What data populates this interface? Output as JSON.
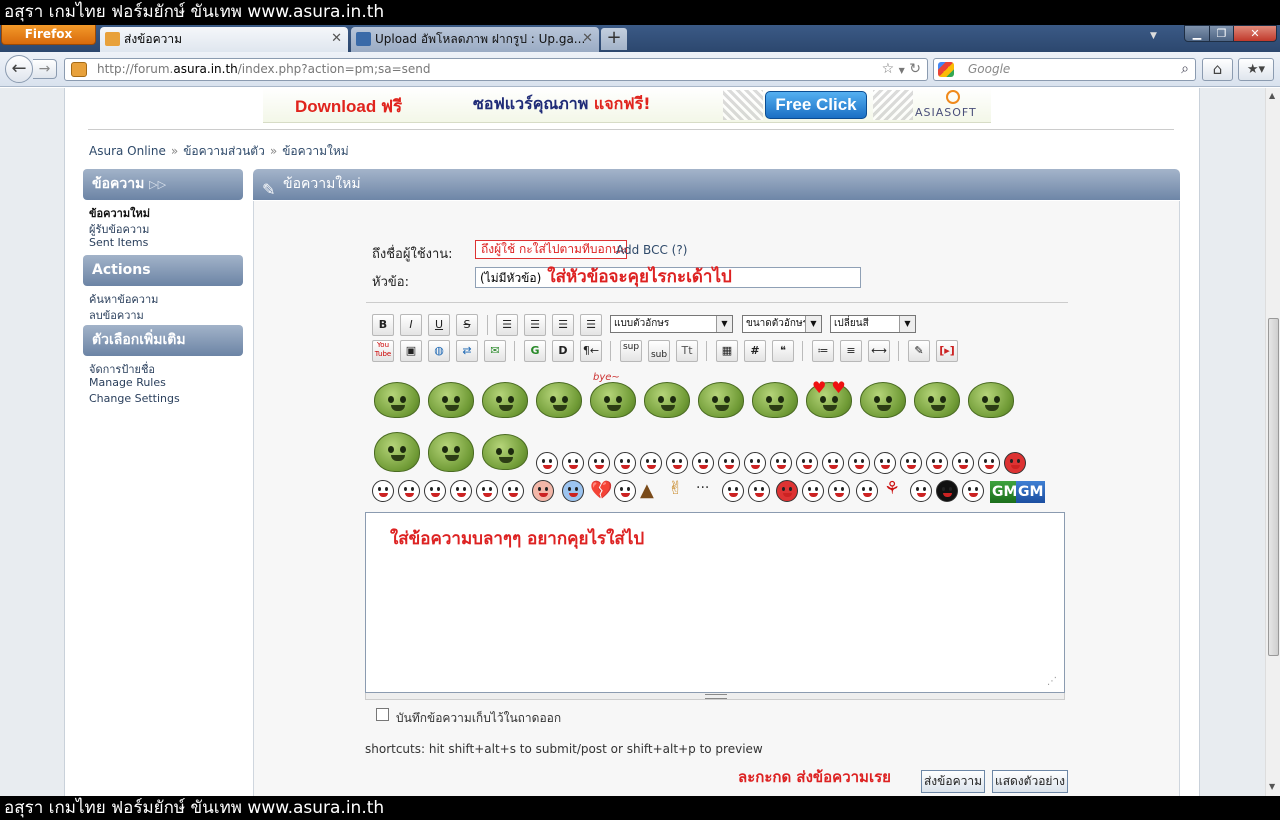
{
  "caption": "อสุรา เกมไทย ฟอร์มยักษ์ ขันเทพ www.asura.in.th",
  "browser": {
    "menu_button": "Firefox",
    "tabs": [
      {
        "title": "ส่งข้อความ",
        "active": true
      },
      {
        "title": "Upload อัพโหลดภาพ ฝากรูป : Up.ga...",
        "active": false
      }
    ],
    "new_tab": "+",
    "url_prefix": "http://forum.",
    "url_host": "asura.in.th",
    "url_path": "/index.php?action=pm;sa=send",
    "search_placeholder": "Google"
  },
  "banner": {
    "download": "Download",
    "free_word": "ฟรี",
    "software": "ซอฟแวร์คุณภาพ",
    "give_free": "แจกฟรี!",
    "free_click": "Free Click",
    "brand": "ASIASOFT"
  },
  "breadcrumb": [
    "Asura Online",
    "ข้อความส่วนตัว",
    "ข้อความใหม่"
  ],
  "breadcrumb_sep": "»",
  "sidebar": {
    "sections": [
      {
        "title": "ข้อความ",
        "items": [
          "ข้อความใหม่",
          "ผู้รับข้อความ",
          "Sent Items"
        ]
      },
      {
        "title": "Actions",
        "items": [
          "ค้นหาข้อความ",
          "ลบข้อความ"
        ]
      },
      {
        "title": "ตัวเลือกเพิ่มเติม",
        "items": [
          "จัดการป้ายชื่อ",
          "Manage Rules",
          "Change Settings"
        ]
      }
    ]
  },
  "panel": {
    "title": "ข้อความใหม่",
    "to_label": "ถึงชื่อผู้ใช้งาน:",
    "to_value": "ถึงผู้ใช้ กะใส่ไปตามทีบอกนะ",
    "add_bcc": "Add BCC (?)",
    "subject_label": "หัวข้อ:",
    "subject_value": "(ไม่มีหัวข้อ)",
    "subject_note": "ใส่หัวข้อจะคุยไรกะเด้าไป",
    "font_select": "แบบตัวอักษร",
    "size_select": "ขนาดตัวอักษร",
    "color_select": "เปลี่ยนสี",
    "message_text": "ใส่ข้อความบลาๆๆ อยากคุยไรใส่ไป",
    "save_outbox": "บันทึกข้อความเก็บไว้ในถาดออก",
    "shortcuts": "shortcuts: hit shift+alt+s to submit/post or shift+alt+p to preview",
    "press_note": "ละกะกด ส่งข้อความเรย",
    "send": "ส่งข้อความ",
    "preview": "แสดงตัวอย่าง"
  },
  "toolbar": {
    "row1": [
      "B",
      "I",
      "U",
      "S"
    ],
    "row2_text": [
      "You Tube",
      "sup",
      "sub",
      "Tt",
      "#"
    ]
  },
  "emoticon_text": [
    "bye~",
    "GM",
    "GM"
  ],
  "colors": {
    "accent": "#6e86a7",
    "note_red": "#d22222",
    "caption": "#000000"
  }
}
